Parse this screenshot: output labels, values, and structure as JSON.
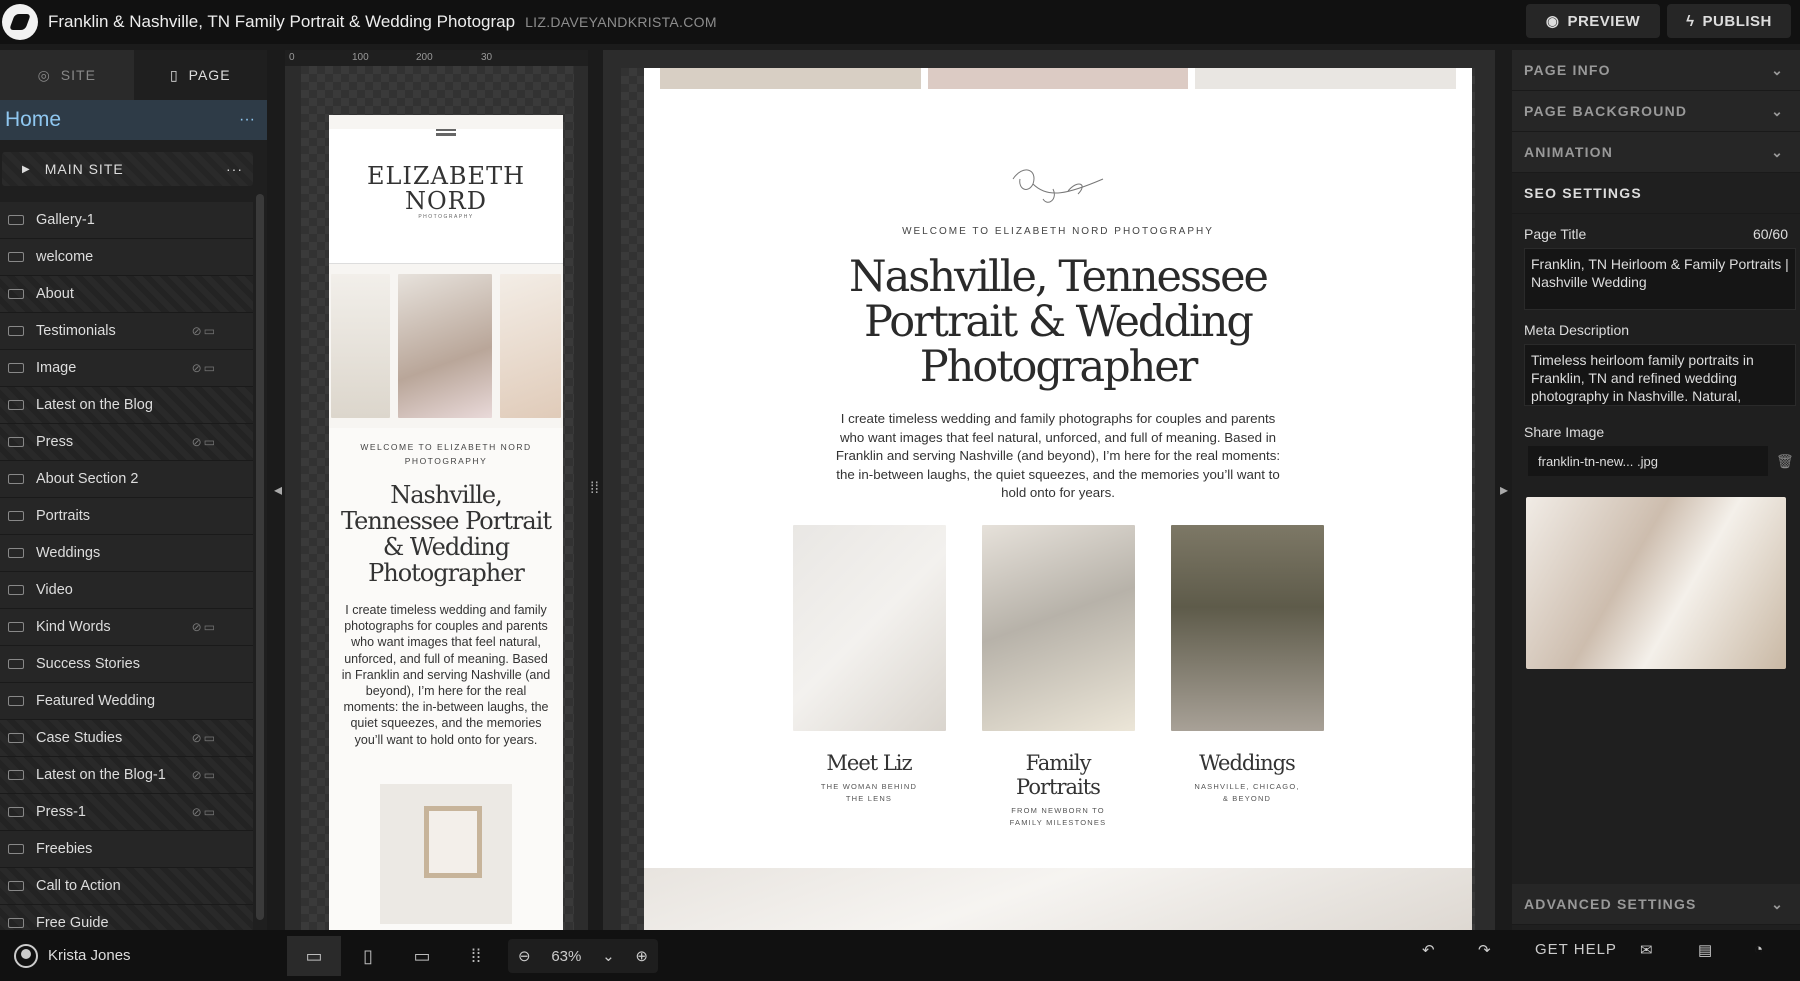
{
  "topbar": {
    "site_title": "Franklin & Nashville, TN Family Portrait & Wedding Photograp",
    "site_url": "LIZ.DAVEYANDKRISTA.COM",
    "preview_label": "PREVIEW",
    "publish_label": "PUBLISH"
  },
  "left_panel": {
    "tab_site": "SITE",
    "tab_page": "PAGE",
    "home_label": "Home",
    "more_icon": "···",
    "main_site_label": "MAIN SITE",
    "pages": [
      {
        "label": "Gallery-1",
        "striped": false,
        "hidden": false
      },
      {
        "label": "welcome",
        "striped": false,
        "hidden": false
      },
      {
        "label": "About",
        "striped": true,
        "hidden": false
      },
      {
        "label": "Testimonials",
        "striped": false,
        "hidden": true
      },
      {
        "label": "Image",
        "striped": false,
        "hidden": true
      },
      {
        "label": "Latest on the Blog",
        "striped": true,
        "hidden": false
      },
      {
        "label": "Press",
        "striped": true,
        "hidden": true
      },
      {
        "label": "About Section 2",
        "striped": false,
        "hidden": false
      },
      {
        "label": "Portraits",
        "striped": false,
        "hidden": false
      },
      {
        "label": "Weddings",
        "striped": false,
        "hidden": false
      },
      {
        "label": "Video",
        "striped": false,
        "hidden": false
      },
      {
        "label": "Kind Words",
        "striped": false,
        "hidden": true
      },
      {
        "label": "Success Stories",
        "striped": false,
        "hidden": false
      },
      {
        "label": "Featured Wedding",
        "striped": false,
        "hidden": false
      },
      {
        "label": "Case Studies",
        "striped": true,
        "hidden": true
      },
      {
        "label": "Latest on the Blog-1",
        "striped": true,
        "hidden": true
      },
      {
        "label": "Press-1",
        "striped": true,
        "hidden": true
      },
      {
        "label": "Freebies",
        "striped": false,
        "hidden": false
      },
      {
        "label": "Call to Action",
        "striped": true,
        "hidden": false
      },
      {
        "label": "Free Guide",
        "striped": true,
        "hidden": false
      }
    ]
  },
  "ruler": {
    "ticks": [
      "0",
      "100",
      "200",
      "30"
    ]
  },
  "mobile_preview": {
    "brand": "ELIZABETH NORD",
    "brand_sub": "PHOTOGRAPHY",
    "welcome": "WELCOME TO ELIZABETH NORD PHOTOGRAPHY",
    "title": "Nashville, Tennessee Portrait & Wedding Photographer",
    "body": "I create timeless wedding and family photographs for couples and parents who want images that feel natural, unforced, and full of meaning. Based in Franklin and serving Nashville (and beyond), I’m here for the real moments: the in-between laughs, the quiet squeezes, and the memories you’ll want to hold onto for years."
  },
  "desktop_preview": {
    "welcome": "WELCOME TO ELIZABETH NORD PHOTOGRAPHY",
    "title": "Nashville, Tennessee Portrait & Wedding Photographer",
    "body": "I create timeless wedding and family photographs for couples and parents who want images that feel natural, unforced, and full of meaning. Based in Franklin and serving Nashville (and beyond), I’m here for the real moments: the in-between laughs, the quiet squeezes, and the memories you’ll want to hold onto for years.",
    "cards": [
      {
        "title": "Meet Liz",
        "sub": "THE WOMAN BEHIND THE LENS"
      },
      {
        "title": "Family Portraits",
        "sub": "FROM NEWBORN TO FAMILY MILESTONES"
      },
      {
        "title": "Weddings",
        "sub": "NASHVILLE, CHICAGO, & BEYOND"
      }
    ]
  },
  "right_panel": {
    "page_info": "PAGE INFO",
    "page_background": "PAGE BACKGROUND",
    "animation": "ANIMATION",
    "seo_settings": "SEO SETTINGS",
    "page_title_label": "Page Title",
    "page_title_count": "60/60",
    "page_title_value": "Franklin, TN Heirloom & Family Portraits | Nashville Wedding",
    "meta_label": "Meta Description",
    "meta_value": "Timeless heirloom family portraits in Franklin, TN and refined wedding photography in Nashville. Natural,",
    "share_label": "Share Image",
    "share_file": "franklin-tn-new... .jpg",
    "advanced": "ADVANCED SETTINGS"
  },
  "bottombar": {
    "user_name": "Krista Jones",
    "zoom": "63%",
    "get_help": "GET HELP"
  },
  "colors": {
    "accent_blue": "#8fc7f0",
    "panel_bg": "#1f1f1f",
    "topbar_bg": "#111111"
  }
}
